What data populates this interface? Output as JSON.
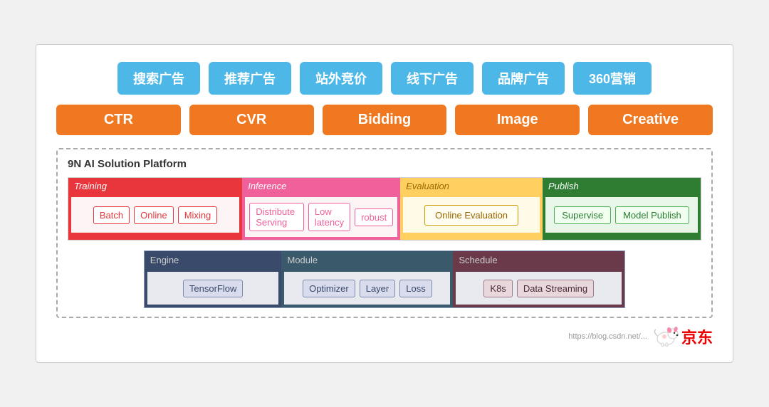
{
  "top_buttons": [
    {
      "label": "搜索广告"
    },
    {
      "label": "推荐广告"
    },
    {
      "label": "站外竞价"
    },
    {
      "label": "线下广告"
    },
    {
      "label": "品牌广告"
    },
    {
      "label": "360营销"
    }
  ],
  "orange_buttons": [
    {
      "label": "CTR"
    },
    {
      "label": "CVR"
    },
    {
      "label": "Bidding"
    },
    {
      "label": "Image"
    },
    {
      "label": "Creative"
    }
  ],
  "platform": {
    "title": "9N AI Solution Platform",
    "training": {
      "header": "Training",
      "items": [
        "Batch",
        "Online",
        "Mixing"
      ]
    },
    "inference": {
      "header": "Inference",
      "items": [
        "Distribute Serving",
        "Low latency",
        "robust"
      ]
    },
    "evaluation": {
      "header": "Evaluation",
      "items": [
        "Online Evaluation"
      ]
    },
    "publish": {
      "header": "Publish",
      "items": [
        "Supervise",
        "Model Publish"
      ]
    },
    "engine": {
      "header": "Engine",
      "items": [
        "TensorFlow"
      ]
    },
    "module": {
      "header": "Module",
      "items": [
        "Optimizer",
        "Layer",
        "Loss"
      ]
    },
    "schedule": {
      "header": "Schedule",
      "items": [
        "K8s",
        "Data Streaming"
      ]
    }
  },
  "footer": {
    "url": "https://blog.csdn.net/...",
    "logo_text": "京东"
  }
}
